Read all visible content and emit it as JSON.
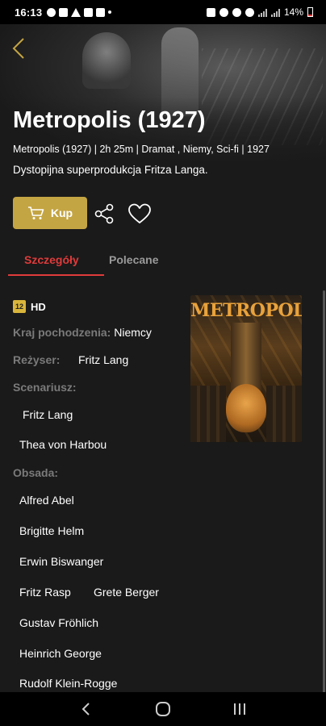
{
  "status_bar": {
    "time": "16:13",
    "battery": "14%"
  },
  "movie": {
    "title": "Metropolis (1927)",
    "meta": "Metropolis (1927) | 2h 25m | Dramat , Niemy, Sci-fi | 1927",
    "description": "Dystopijna superprodukcja Fritza Langa."
  },
  "actions": {
    "buy_label": "Kup"
  },
  "tabs": [
    {
      "label": "Szczegóły",
      "active": true
    },
    {
      "label": "Polecane",
      "active": false
    }
  ],
  "details": {
    "age_rating": "12",
    "quality": "HD",
    "country_label": "Kraj pochodzenia:",
    "country_value": "Niemcy",
    "director_label": "Reżyser:",
    "director_value": "Fritz Lang",
    "writers_label": "Scenariusz:",
    "writers": [
      "Fritz Lang",
      "Thea von Harbou"
    ],
    "cast_label": "Obsada:",
    "cast": [
      "Alfred Abel",
      "Brigitte Helm",
      "Erwin Biswanger",
      "Fritz Rasp",
      "Grete Berger",
      "Gustav Fröhlich",
      "Heinrich George",
      "Rudolf Klein-Rogge"
    ]
  },
  "poster": {
    "title_text": "METROPOLIS"
  },
  "colors": {
    "accent": "#c4a543",
    "active_tab": "#e03a3a",
    "background": "#1a1a1a",
    "label": "#7a7a7a"
  },
  "icons": {
    "back": "chevron-left-icon",
    "cart": "cart-icon",
    "share": "share-icon",
    "favorite": "heart-icon"
  }
}
